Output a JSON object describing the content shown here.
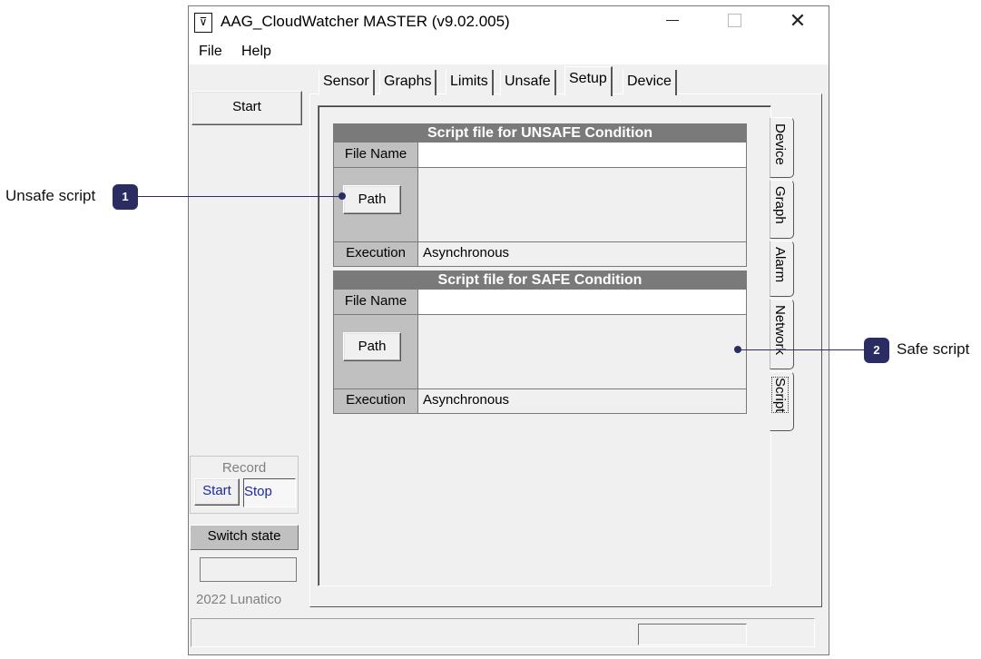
{
  "window": {
    "title": "AAG_CloudWatcher MASTER (v9.02.005)",
    "controls": {
      "minimize": "─",
      "close": "✕"
    }
  },
  "menu": [
    "File",
    "Help"
  ],
  "left_panel": {
    "start_label": "Start",
    "record": {
      "label": "Record",
      "start": "Start",
      "stop": "Stop"
    },
    "switch_state": "Switch state",
    "copyright": "2022 Lunatico"
  },
  "tabs": [
    "Sensor",
    "Graphs",
    "Limits",
    "Unsafe",
    "Setup",
    "Device"
  ],
  "active_tab": "Setup",
  "side_tabs": [
    "Device",
    "Graph",
    "Alarm",
    "Network",
    "Script"
  ],
  "active_side_tab": "Script",
  "unsafe_script": {
    "header": "Script file for UNSAFE Condition",
    "file_name_label": "File Name",
    "file_name_value": "",
    "path_button": "Path",
    "execution_label": "Execution",
    "execution_value": "Asynchronous"
  },
  "safe_script": {
    "header": "Script file for SAFE Condition",
    "file_name_label": "File Name",
    "file_name_value": "",
    "path_button": "Path",
    "execution_label": "Execution",
    "execution_value": "Asynchronous"
  },
  "callouts": [
    {
      "number": "1",
      "label": "Unsafe script"
    },
    {
      "number": "2",
      "label": "Safe script"
    }
  ],
  "colors": {
    "callout": "#2b2d62",
    "table_header": "#7a7a7a",
    "window_bg": "#f0f0f0"
  }
}
